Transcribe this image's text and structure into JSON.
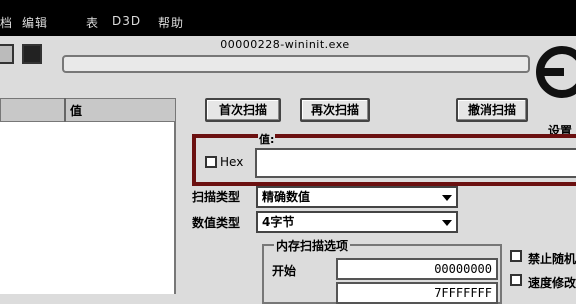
{
  "menubar": {
    "items": [
      "档",
      "编辑",
      "表",
      "D3D",
      "帮助"
    ]
  },
  "process_title": "00000228-wininit.exe",
  "scan_progress": 0,
  "list": {
    "col_address": "",
    "col_value": "值"
  },
  "buttons": {
    "first_scan": "首次扫描",
    "next_scan": "再次扫描",
    "cancel_scan": "撤消扫描"
  },
  "settings_label": "设置",
  "value_group": {
    "label": "值:",
    "hex_label": "Hex",
    "hex_checked": false,
    "value_input": ""
  },
  "scan_type": {
    "label": "扫描类型",
    "selected": "精确数值"
  },
  "value_type": {
    "label": "数值类型",
    "selected": "4字节"
  },
  "memory_options": {
    "title": "内存扫描选项",
    "start_label": "开始",
    "start_value": "00000000",
    "stop_value": "7FFFFFFF"
  },
  "right_options": {
    "option1": "禁止随机",
    "option2": "速度修改"
  },
  "colors": {
    "highlight_frame": "#6b1010",
    "menubar_bg": "#000000"
  }
}
